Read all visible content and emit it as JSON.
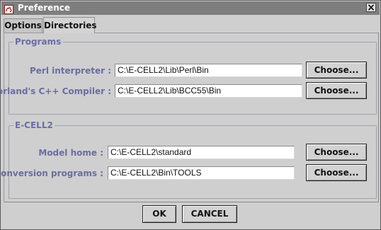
{
  "window": {
    "title": "Preference"
  },
  "tabs": [
    {
      "label": "Options",
      "selected": false
    },
    {
      "label": "Directories",
      "selected": true
    }
  ],
  "groups": {
    "programs": {
      "title": "Programs",
      "rows": [
        {
          "label": "Perl interpreter :",
          "value": "C:\\E-CELL2\\Lib\\Perl\\Bin",
          "button": "Choose..."
        },
        {
          "label": "Borland's C++ Compiler :",
          "value": "C:\\E-CELL2\\Lib\\BCC55\\Bin",
          "button": "Choose..."
        }
      ]
    },
    "ecell": {
      "title": "E-CELL2",
      "rows": [
        {
          "label": "Model home :",
          "value": "C:\\E-CELL2\\standard",
          "button": "Choose..."
        },
        {
          "label": "Conversion programs :",
          "value": "C:\\E-CELL2\\Bin\\TOOLS",
          "button": "Choose..."
        }
      ]
    }
  },
  "footer": {
    "ok_label": "OK",
    "cancel_label": "CANCEL"
  },
  "colors": {
    "group_label": "#6a6ea3",
    "titlebar": "#7e7e7e"
  },
  "icons": {
    "app": "app-icon",
    "close": "close-icon"
  }
}
